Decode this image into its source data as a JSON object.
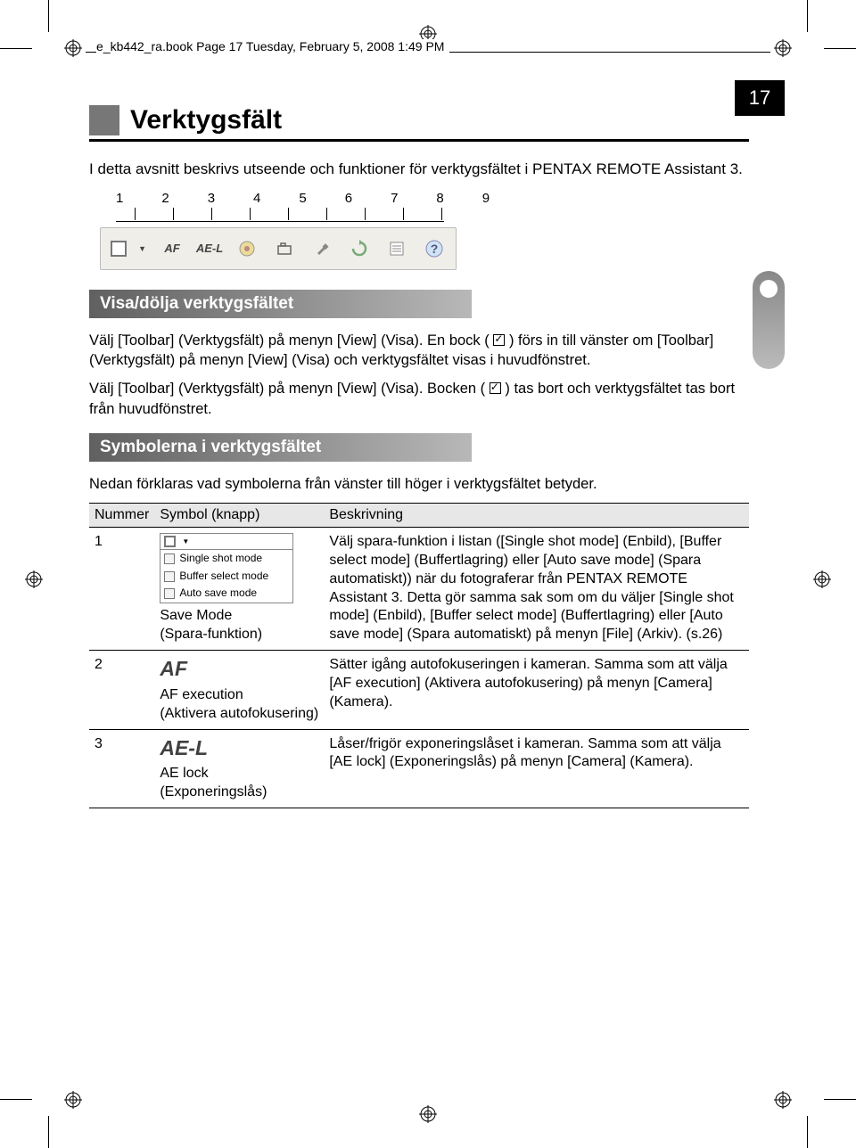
{
  "header_line": "e_kb442_ra.book  Page 17  Tuesday, February 5, 2008  1:49 PM",
  "page_number": "17",
  "section_title": "Verktygsfält",
  "intro": "I detta avsnitt beskrivs utseende och funktioner för verktygsfältet i PENTAX REMOTE Assistant 3.",
  "toolbar_numbers": [
    "1",
    "2",
    "3",
    "4",
    "5",
    "6",
    "7",
    "8",
    "9"
  ],
  "toolbar_icons": {
    "af": "AF",
    "ael": "AE-L"
  },
  "sub1_title": "Visa/dölja verktygsfältet",
  "sub1_p1a": "Välj [Toolbar] (Verktygsfält) på menyn [View] (Visa). En bock (",
  "sub1_p1b": ") förs in till vänster om [Toolbar] (Verktygsfält) på menyn [View] (Visa) och verktygsfältet visas i huvudfönstret.",
  "sub1_p2a": "Välj [Toolbar] (Verktygsfält) på menyn [View] (Visa). Bocken (",
  "sub1_p2b": ") tas bort och verktygsfältet tas bort från huvudfönstret.",
  "sub2_title": "Symbolerna i verktygsfältet",
  "sub2_intro": "Nedan förklaras vad symbolerna från vänster till höger i verktygsfältet betyder.",
  "table": {
    "headers": {
      "num": "Nummer",
      "sym": "Symbol (knapp)",
      "desc": "Beskrivning"
    },
    "rows": [
      {
        "num": "1",
        "sym_label": "Save Mode\n(Spara-funktion)",
        "menu": {
          "opt1": "Single shot mode",
          "opt2": "Buffer select mode",
          "opt3": "Auto save mode"
        },
        "desc": "Välj spara-funktion i listan ([Single shot mode] (Enbild), [Buffer select mode] (Buffertlagring) eller [Auto save mode] (Spara automatiskt)) när du fotograferar från PENTAX REMOTE Assistant 3. Detta gör samma sak som om du väljer [Single shot mode] (Enbild), [Buffer select mode] (Buffertlagring) eller [Auto save mode] (Spara automatiskt) på menyn [File] (Arkiv). (s.26)"
      },
      {
        "num": "2",
        "icon": "AF",
        "sym_label": "AF execution\n(Aktivera autofokusering)",
        "desc": "Sätter igång autofokuseringen i kameran. Samma som att välja [AF execution] (Aktivera autofokusering) på menyn [Camera] (Kamera)."
      },
      {
        "num": "3",
        "icon": "AE-L",
        "sym_label": "AE lock\n(Exponeringslås)",
        "desc": "Låser/frigör exponeringslåset i kameran. Samma som att välja [AE lock] (Exponeringslås) på menyn [Camera] (Kamera)."
      }
    ]
  }
}
